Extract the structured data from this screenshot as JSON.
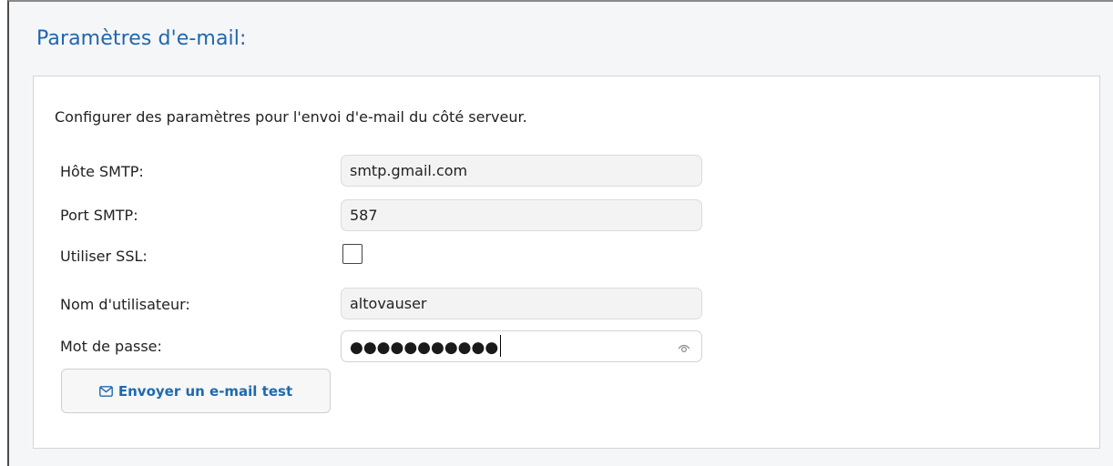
{
  "section": {
    "title": "Paramètres d'e-mail:"
  },
  "intro": "Configurer des paramètres pour l'envoi d'e-mail du côté serveur.",
  "fields": {
    "smtp_host": {
      "label": "Hôte SMTP:",
      "value": "smtp.gmail.com"
    },
    "smtp_port": {
      "label": "Port SMTP:",
      "value": "587"
    },
    "use_ssl": {
      "label": "Utiliser SSL:",
      "checked": false
    },
    "username": {
      "label": "Nom d'utilisateur:",
      "value": "altovauser"
    },
    "password": {
      "label": "Mot de passe:",
      "masked_value": "●●●●●●●●●●●",
      "icon": "eye-icon"
    }
  },
  "test_button": {
    "label": "Envoyer un e-mail test",
    "icon": "envelope-icon"
  },
  "colors": {
    "title": "#2266aa",
    "button_text": "#1f6aae",
    "frame_background": "#f5f6f8",
    "panel_background": "#ffffff",
    "field_background": "#f3f3f3"
  }
}
